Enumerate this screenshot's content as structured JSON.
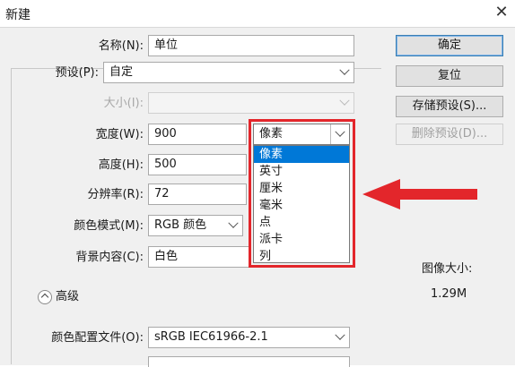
{
  "window": {
    "title": "新建",
    "close_glyph": "✕"
  },
  "form": {
    "name": {
      "label": "名称(N):",
      "value": "单位"
    },
    "preset": {
      "label": "预设(P):",
      "value": "自定"
    },
    "size": {
      "label": "大小(I):",
      "value": ""
    },
    "width": {
      "label": "宽度(W):",
      "value": "900",
      "unit": "像素"
    },
    "height": {
      "label": "高度(H):",
      "value": "500"
    },
    "resolution": {
      "label": "分辨率(R):",
      "value": "72"
    },
    "color_mode": {
      "label": "颜色模式(M):",
      "value": "RGB 颜色"
    },
    "background": {
      "label": "背景内容(C):",
      "value": "白色"
    },
    "advanced": {
      "label": "高级"
    },
    "color_profile": {
      "label": "颜色配置文件(O):",
      "value": "sRGB IEC61966-2.1"
    }
  },
  "unit_options": [
    "像素",
    "英寸",
    "厘米",
    "毫米",
    "点",
    "派卡",
    "列"
  ],
  "unit_selected_index": 0,
  "buttons": {
    "ok": "确定",
    "reset": "复位",
    "save_preset": "存储预设(S)...",
    "delete_preset": "删除预设(D)..."
  },
  "image_size": {
    "label": "图像大小:",
    "value": "1.29M"
  },
  "annotation": {
    "arrow_color": "#e3262b",
    "box_color": "#e3262b"
  }
}
